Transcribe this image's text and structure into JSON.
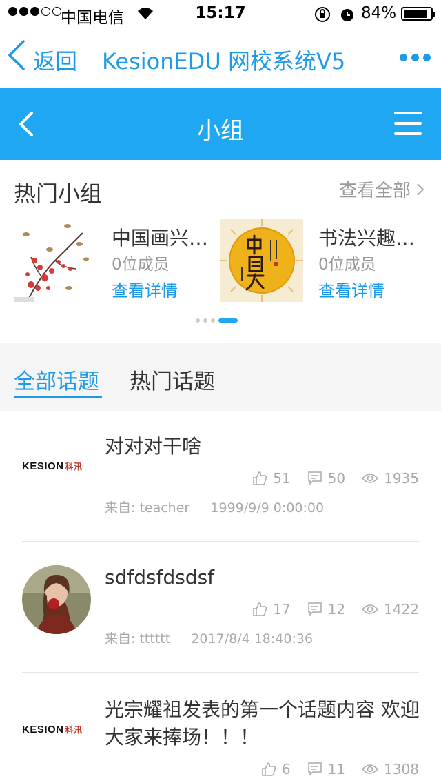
{
  "status_bar": {
    "carrier": "中国电信",
    "time": "15:17",
    "battery": "84%",
    "battery_level": 0.84
  },
  "browser_nav": {
    "back_label": "返回",
    "title": "KesionEDU 网校系统V5"
  },
  "app_header": {
    "title": "小组"
  },
  "hot_groups": {
    "title": "热门小组",
    "view_all": "查看全部",
    "groups": [
      {
        "name": "中国画兴…",
        "members": "0位成员",
        "detail": "查看详情"
      },
      {
        "name": "书法兴趣…",
        "members": "0位成员",
        "detail": "查看详情"
      }
    ],
    "pager_count": 4,
    "pager_active": 4
  },
  "tabs": [
    {
      "label": "全部话题",
      "active": true
    },
    {
      "label": "热门话题",
      "active": false
    }
  ],
  "topics": [
    {
      "title": "对对对干啥",
      "likes": "51",
      "comments": "50",
      "views": "1935",
      "from": "来自:  teacher",
      "time": "1999/9/9 0:00:00",
      "avatar": "kesion-logo"
    },
    {
      "title": "sdfdsfdsdsf",
      "likes": "17",
      "comments": "12",
      "views": "1422",
      "from": "来自:  tttttt",
      "time": "2017/8/4 18:40:36",
      "avatar": "user-photo"
    },
    {
      "title": "光宗耀祖发表的第一个话题内容 欢迎大家来捧场！！！",
      "likes": "6",
      "comments": "11",
      "views": "1308",
      "avatar": "kesion-logo"
    }
  ],
  "brand": {
    "logo_text": "KESION",
    "logo_cn": "科汛"
  },
  "colors": {
    "accent": "#1fa7f2",
    "link": "#1e9be8"
  }
}
